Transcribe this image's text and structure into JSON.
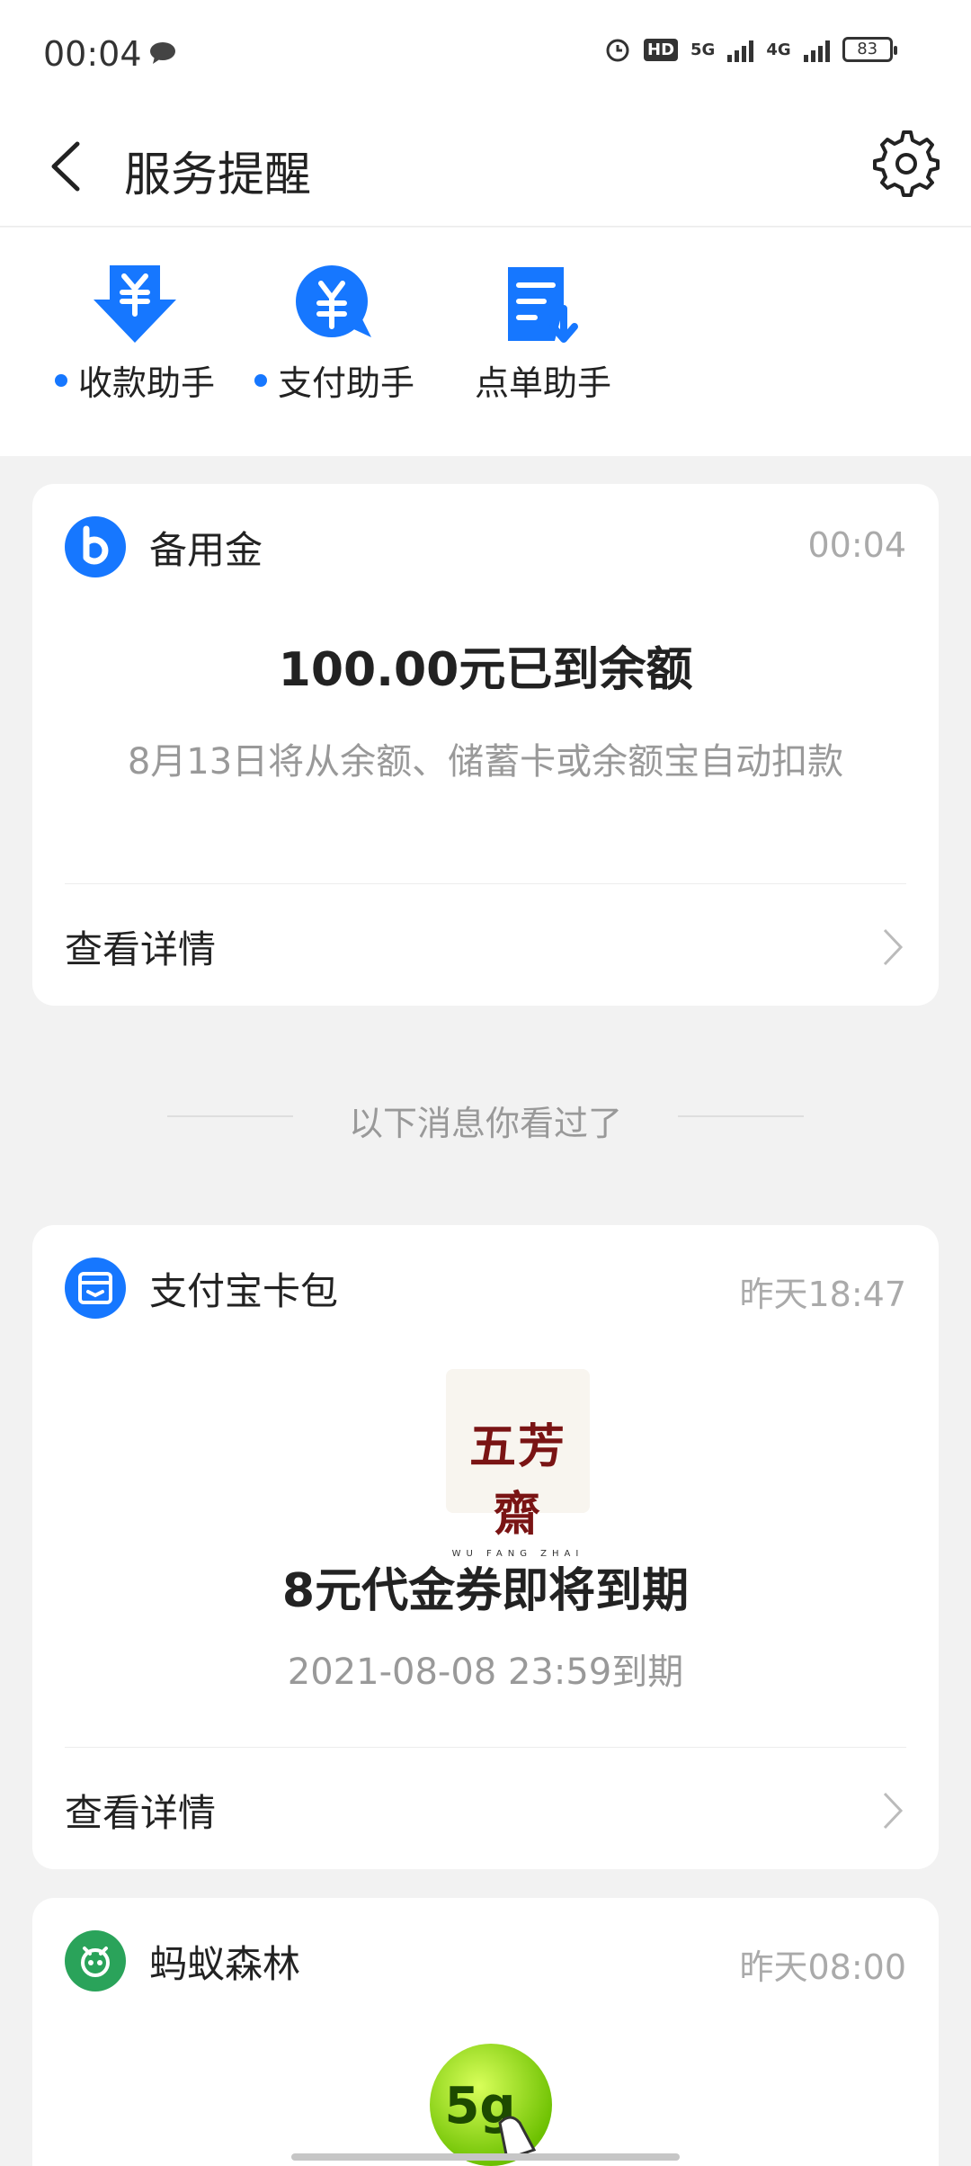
{
  "status_bar": {
    "time": "00:04",
    "hd": "HD",
    "network1": "5G",
    "network2": "4G",
    "battery": "83"
  },
  "header": {
    "title": "服务提醒"
  },
  "assistants": [
    {
      "label": "收款助手",
      "unread": true
    },
    {
      "label": "支付助手",
      "unread": true
    },
    {
      "label": "点单助手",
      "unread": false
    }
  ],
  "cards": [
    {
      "app": "备用金",
      "time": "00:04",
      "headline": "100.00元已到余额",
      "subtitle": "8月13日将从余额、储蓄卡或余额宝自动扣款",
      "link": "查看详情"
    },
    {
      "app": "支付宝卡包",
      "time": "昨天18:47",
      "brand_cn": "五芳齋",
      "brand_en": "WU FANG ZHAI",
      "headline": "8元代金券即将到期",
      "subtitle": "2021-08-08 23:59到期",
      "link": "查看详情"
    },
    {
      "app": "蚂蚁森林",
      "time": "昨天08:00",
      "energy": "5g"
    }
  ],
  "seen_divider": "以下消息你看过了",
  "colors": {
    "accent": "#1677ff",
    "forest": "#2aa35a",
    "energy": "#8fd400"
  }
}
